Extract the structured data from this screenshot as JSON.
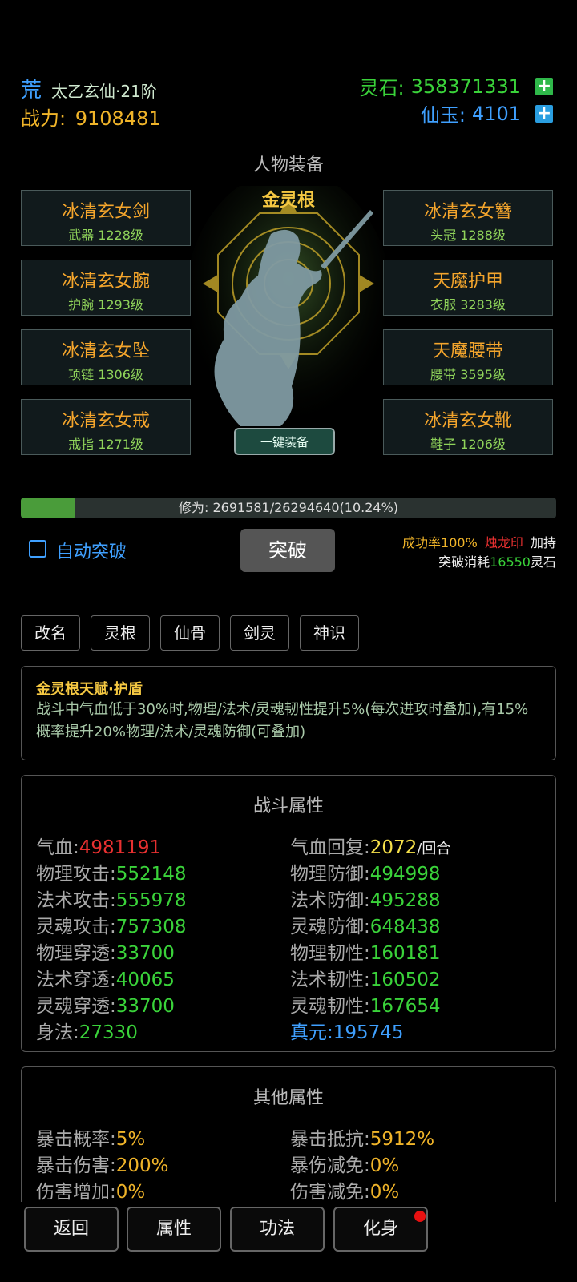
{
  "header": {
    "realm_tag": "荒",
    "realm_name": "太乙玄仙·21阶",
    "power_label": "战力:",
    "power_value": "9108481",
    "spirit_stone_label": "灵石:",
    "spirit_stone_value": "358371331",
    "jade_label": "仙玉:",
    "jade_value": "4101",
    "plus": "+"
  },
  "equipment_title": "人物装备",
  "spirit_root": "金灵根",
  "equip_all_label": "一键装备",
  "equipment_left": [
    {
      "name": "冰清玄女剑",
      "slot": "武器",
      "level": "1228级"
    },
    {
      "name": "冰清玄女腕",
      "slot": "护腕",
      "level": "1293级"
    },
    {
      "name": "冰清玄女坠",
      "slot": "项链",
      "level": "1306级"
    },
    {
      "name": "冰清玄女戒",
      "slot": "戒指",
      "level": "1271级"
    }
  ],
  "equipment_right": [
    {
      "name": "冰清玄女簪",
      "slot": "头冠",
      "level": "1288级"
    },
    {
      "name": "天魔护甲",
      "slot": "衣服",
      "level": "3283级"
    },
    {
      "name": "天魔腰带",
      "slot": "腰带",
      "level": "3595级"
    },
    {
      "name": "冰清玄女靴",
      "slot": "鞋子",
      "level": "1206级"
    }
  ],
  "cultivation": {
    "label": "修为:",
    "value": "2691581/26294640(10.24%)",
    "progress_pct": 10.24
  },
  "auto_break_label": "自动突破",
  "break_button": "突破",
  "break_info": {
    "success": "成功率100%",
    "seal": "烛龙印",
    "bonus": "加持",
    "cost_prefix": "突破消耗",
    "cost_value": "16550",
    "cost_suffix": "灵石"
  },
  "tabs": [
    "改名",
    "灵根",
    "仙骨",
    "剑灵",
    "神识"
  ],
  "talent": {
    "title": "金灵根天赋·护盾",
    "desc": "战斗中气血低于30%时,物理/法术/灵魂韧性提升5%(每次进攻时叠加),有15%概率提升20%物理/法术/灵魂防御(可叠加)"
  },
  "combat": {
    "title": "战斗属性",
    "left": [
      {
        "label": "气血:",
        "value": "4981191"
      },
      {
        "label": "物理攻击:",
        "value": "552148"
      },
      {
        "label": "法术攻击:",
        "value": "555978"
      },
      {
        "label": "灵魂攻击:",
        "value": "757308"
      },
      {
        "label": "物理穿透:",
        "value": "33700"
      },
      {
        "label": "法术穿透:",
        "value": "40065"
      },
      {
        "label": "灵魂穿透:",
        "value": "33700"
      },
      {
        "label": "身法:",
        "value": "27330"
      }
    ],
    "right": [
      {
        "label": "气血回复:",
        "value": "2072",
        "suffix": "/回合"
      },
      {
        "label": "物理防御:",
        "value": "494998"
      },
      {
        "label": "法术防御:",
        "value": "495288"
      },
      {
        "label": "灵魂防御:",
        "value": "648438"
      },
      {
        "label": "物理韧性:",
        "value": "160181"
      },
      {
        "label": "法术韧性:",
        "value": "160502"
      },
      {
        "label": "灵魂韧性:",
        "value": "167654"
      },
      {
        "label": "真元:",
        "value": "195745"
      }
    ]
  },
  "other": {
    "title": "其他属性",
    "left": [
      {
        "label": "暴击概率:",
        "value": "5%"
      },
      {
        "label": "暴击伤害:",
        "value": "200%"
      },
      {
        "label": "伤害增加:",
        "value": "0%"
      }
    ],
    "right": [
      {
        "label": "暴击抵抗:",
        "value": "5912%"
      },
      {
        "label": "暴伤减免:",
        "value": "0%"
      },
      {
        "label": "伤害减免:",
        "value": "0%"
      }
    ]
  },
  "bottom_nav": [
    "返回",
    "属性",
    "功法",
    "化身"
  ],
  "colors": {
    "gold": "#f0b429",
    "green": "#3ad33a",
    "blue": "#3fa0ff",
    "red": "#e83030"
  }
}
